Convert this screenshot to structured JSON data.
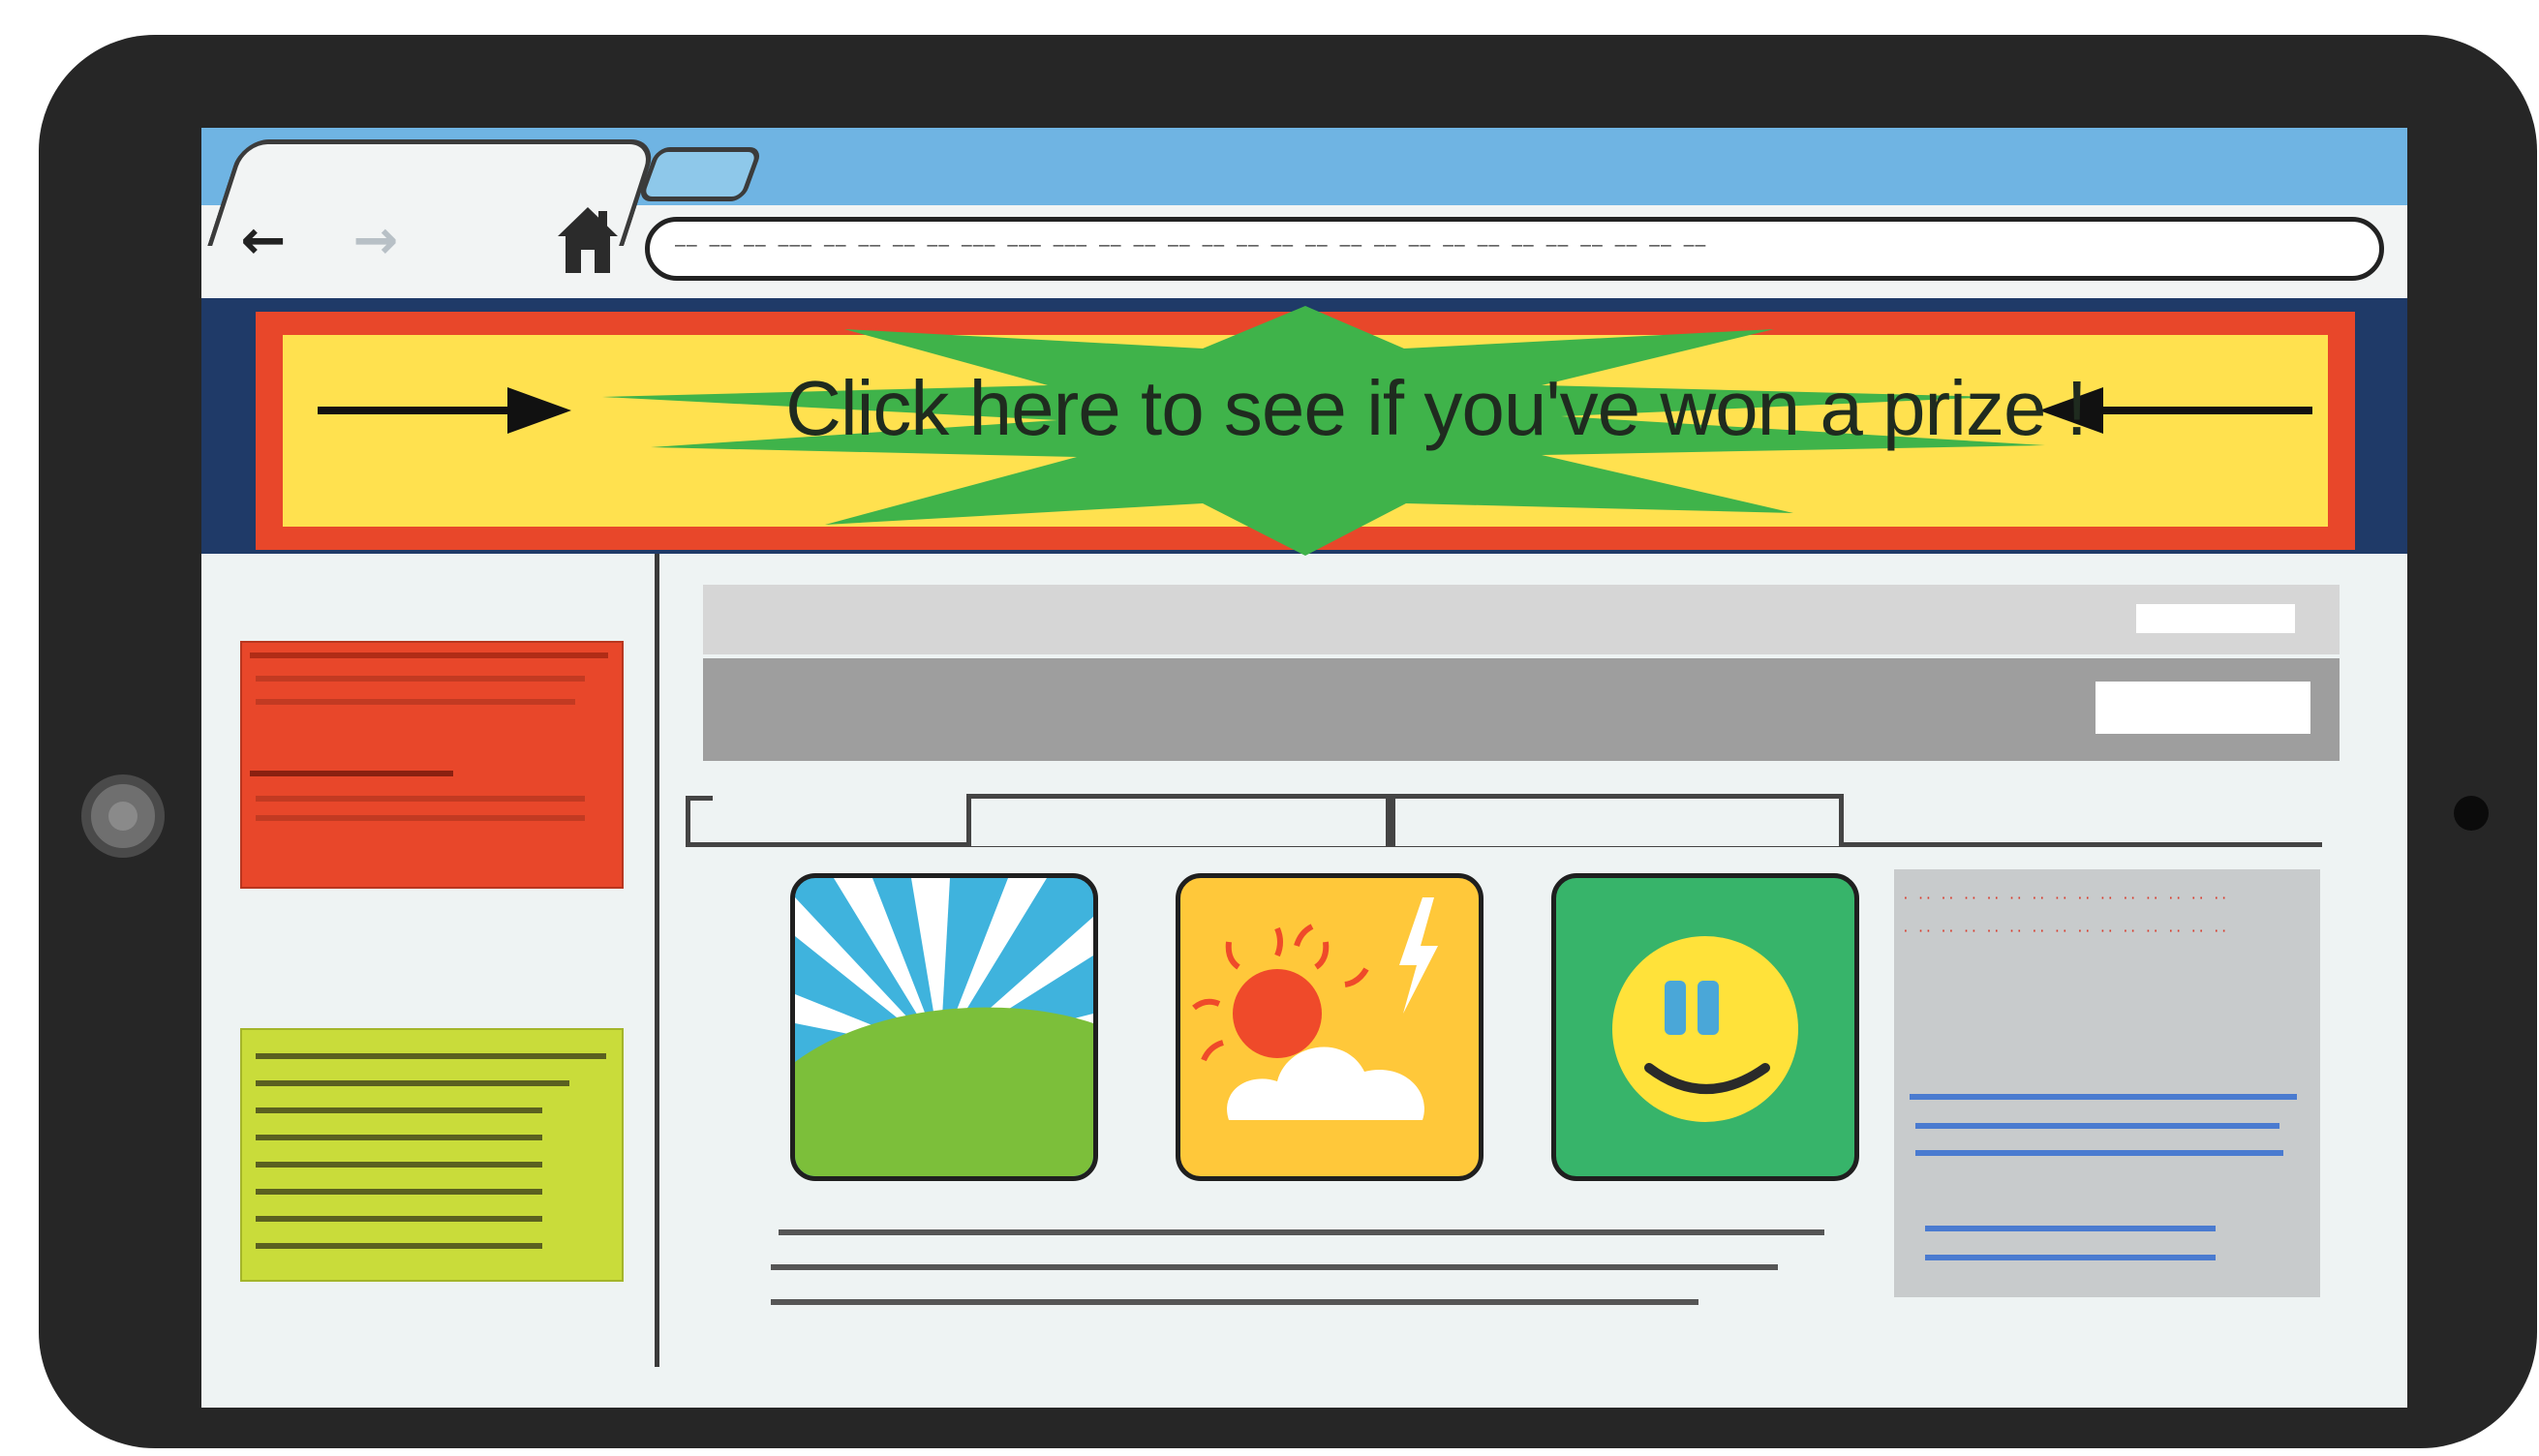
{
  "browser": {
    "back_label": "←",
    "forward_label": "→",
    "address": "—— —— —— ——— —— —— —— —— ——— ——— ——— —— —— —— —— —— —— —— —— —— —— —— —— —— —— —— —— —— ——"
  },
  "ad_banner": {
    "text": "Click here to see if you've won a prize !",
    "colors": {
      "outer": "#e8472a",
      "inner": "#ffe14f",
      "burst": "#3fb34a",
      "frame": "#1f3a68"
    }
  },
  "right_panel": {
    "red_lines": [
      "· ·· ·· ·· ·· ·· ·· ·· ·· ·· ·· ·· ·· ·· ··",
      "· ·· ·· ·· ·· ·· ·· ·· ·· ·· ·· ·· ·· ·· ··"
    ]
  },
  "icons": [
    "home-icon",
    "back-arrow-icon",
    "forward-arrow-icon",
    "landscape-icon",
    "weather-icon",
    "smiley-icon",
    "camera-icon"
  ]
}
